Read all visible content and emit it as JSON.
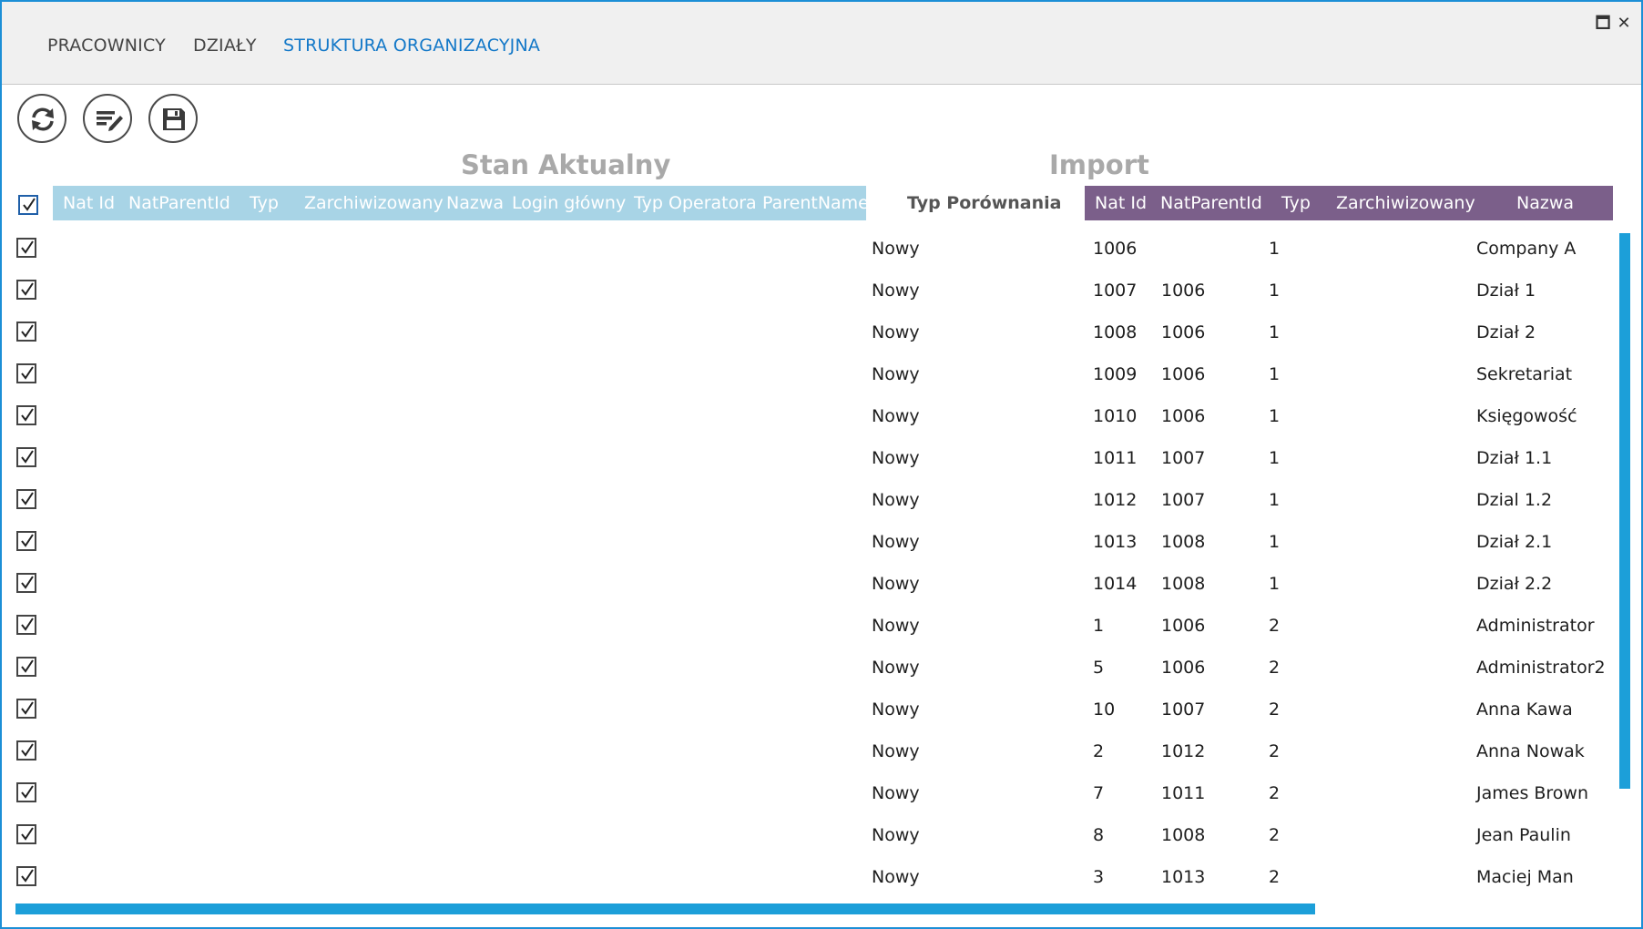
{
  "tabs": [
    {
      "label": "PRACOWNICY",
      "active": false
    },
    {
      "label": "DZIAŁY",
      "active": false
    },
    {
      "label": "STRUKTURA ORGANIZACYJNA",
      "active": true
    }
  ],
  "window_controls": {
    "maximize": "🗖",
    "close": "✕"
  },
  "toolbar": [
    {
      "name": "refresh-icon"
    },
    {
      "name": "edit-list-icon"
    },
    {
      "name": "save-icon"
    }
  ],
  "sections": {
    "current_title": "Stan Aktualny",
    "import_title": "Import",
    "compare_header": "Typ Porównania"
  },
  "current_columns": [
    "Nat Id",
    "NatParentId",
    "Typ",
    "Zarchiwizowany",
    "Nazwa",
    "Login główny",
    "Typ Operatora",
    "ParentName"
  ],
  "import_columns": [
    "Nat Id",
    "NatParentId",
    "Typ",
    "Zarchiwizowany",
    "Nazwa"
  ],
  "colors": {
    "accent": "#1378c8",
    "current_header_bg": "#a8d4e6",
    "import_header_bg": "#7b5f8a",
    "scrollbar": "#1c9fd9"
  },
  "rows": [
    {
      "checked": true,
      "compare": "Nowy",
      "nat_id": "1006",
      "parent_id": "",
      "typ": "1",
      "nazwa": "Company A"
    },
    {
      "checked": true,
      "compare": "Nowy",
      "nat_id": "1007",
      "parent_id": "1006",
      "typ": "1",
      "nazwa": "Dział 1"
    },
    {
      "checked": true,
      "compare": "Nowy",
      "nat_id": "1008",
      "parent_id": "1006",
      "typ": "1",
      "nazwa": "Dział 2"
    },
    {
      "checked": true,
      "compare": "Nowy",
      "nat_id": "1009",
      "parent_id": "1006",
      "typ": "1",
      "nazwa": "Sekretariat"
    },
    {
      "checked": true,
      "compare": "Nowy",
      "nat_id": "1010",
      "parent_id": "1006",
      "typ": "1",
      "nazwa": "Księgowość"
    },
    {
      "checked": true,
      "compare": "Nowy",
      "nat_id": "1011",
      "parent_id": "1007",
      "typ": "1",
      "nazwa": "Dział 1.1"
    },
    {
      "checked": true,
      "compare": "Nowy",
      "nat_id": "1012",
      "parent_id": "1007",
      "typ": "1",
      "nazwa": "Dzial 1.2"
    },
    {
      "checked": true,
      "compare": "Nowy",
      "nat_id": "1013",
      "parent_id": "1008",
      "typ": "1",
      "nazwa": "Dział 2.1"
    },
    {
      "checked": true,
      "compare": "Nowy",
      "nat_id": "1014",
      "parent_id": "1008",
      "typ": "1",
      "nazwa": "Dział 2.2"
    },
    {
      "checked": true,
      "compare": "Nowy",
      "nat_id": "1",
      "parent_id": "1006",
      "typ": "2",
      "nazwa": "Administrator"
    },
    {
      "checked": true,
      "compare": "Nowy",
      "nat_id": "5",
      "parent_id": "1006",
      "typ": "2",
      "nazwa": "Administrator2"
    },
    {
      "checked": true,
      "compare": "Nowy",
      "nat_id": "10",
      "parent_id": "1007",
      "typ": "2",
      "nazwa": "Anna Kawa"
    },
    {
      "checked": true,
      "compare": "Nowy",
      "nat_id": "2",
      "parent_id": "1012",
      "typ": "2",
      "nazwa": "Anna Nowak"
    },
    {
      "checked": true,
      "compare": "Nowy",
      "nat_id": "7",
      "parent_id": "1011",
      "typ": "2",
      "nazwa": "James Brown"
    },
    {
      "checked": true,
      "compare": "Nowy",
      "nat_id": "8",
      "parent_id": "1008",
      "typ": "2",
      "nazwa": "Jean Paulin"
    },
    {
      "checked": true,
      "compare": "Nowy",
      "nat_id": "3",
      "parent_id": "1013",
      "typ": "2",
      "nazwa": "Maciej Man"
    }
  ]
}
